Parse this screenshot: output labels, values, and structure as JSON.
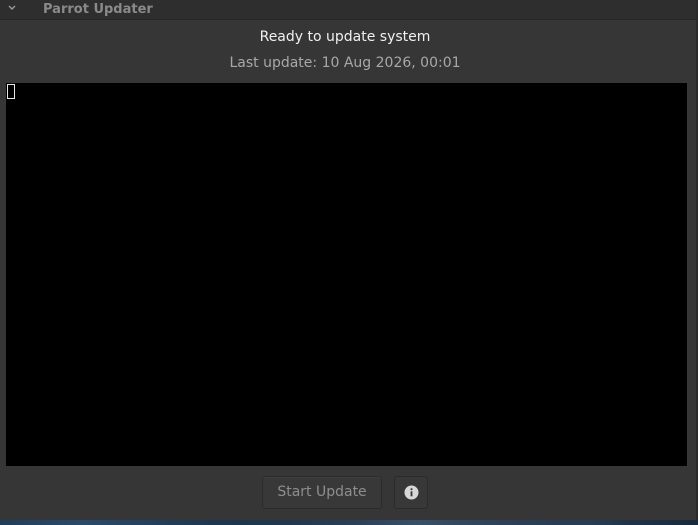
{
  "window": {
    "title": "Parrot Updater",
    "collapse_icon": "chevron-down-icon"
  },
  "status": {
    "message": "Ready to update system",
    "last_update": "Last update: 10 Aug 2026, 00:01"
  },
  "terminal": {
    "content": ""
  },
  "actions": {
    "start_label": "Start Update",
    "start_enabled": false,
    "info_icon": "info-icon"
  },
  "colors": {
    "window_bg": "#363636",
    "terminal_bg": "#000000",
    "title_text": "#8a8a8a",
    "primary_text": "#f0f0f0",
    "secondary_text": "#a8a8a8"
  }
}
